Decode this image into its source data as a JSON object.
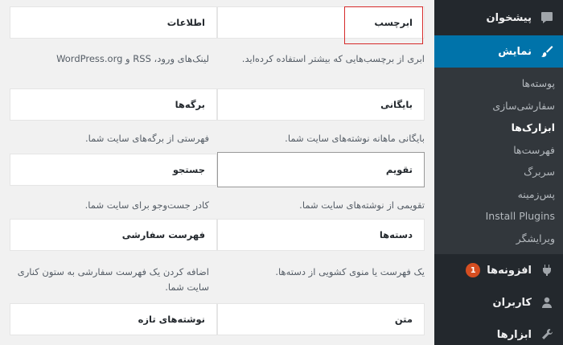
{
  "sidebar": {
    "dashboard": "پیشخوان",
    "appearance": "نمایش",
    "submenu": [
      "پوسته‌ها",
      "سفارشی‌سازی",
      "ابزارک‌ها",
      "فهرست‌ها",
      "سربرگ",
      "پس‌زمینه",
      "Install Plugins",
      "ویرایشگر"
    ],
    "plugins": "افزونه‌ها",
    "plugins_badge": "1",
    "users": "کاربران",
    "tools": "ابزارها"
  },
  "widgets": [
    {
      "title": "ابرچسب",
      "desc": "ابری از برچسب‌هایی که بیشتر استفاده کرده‌اید."
    },
    {
      "title": "اطلاعات",
      "desc": "لینک‌های ورود، RSS و WordPress.org"
    },
    {
      "title": "بایگانی",
      "desc": "بایگانی ماهانه نوشته‌های سایت شما."
    },
    {
      "title": "برگه‌ها",
      "desc": "فهرستی از برگه‌های سایت شما."
    },
    {
      "title": "تقویم",
      "desc": "تقویمی از نوشته‌های سایت شما."
    },
    {
      "title": "جستجو",
      "desc": "کادر جست‌وجو برای سایت شما."
    },
    {
      "title": "دسته‌ها",
      "desc": "یک فهرست یا منوی کشویی از دسته‌ها."
    },
    {
      "title": "فهرست سفارشی",
      "desc": "اضافه کردن یک فهرست سفارشی به ستون کناری سایت شما."
    },
    {
      "title": "متن",
      "desc": ""
    },
    {
      "title": "نوشته‌های تازه",
      "desc": ""
    }
  ]
}
